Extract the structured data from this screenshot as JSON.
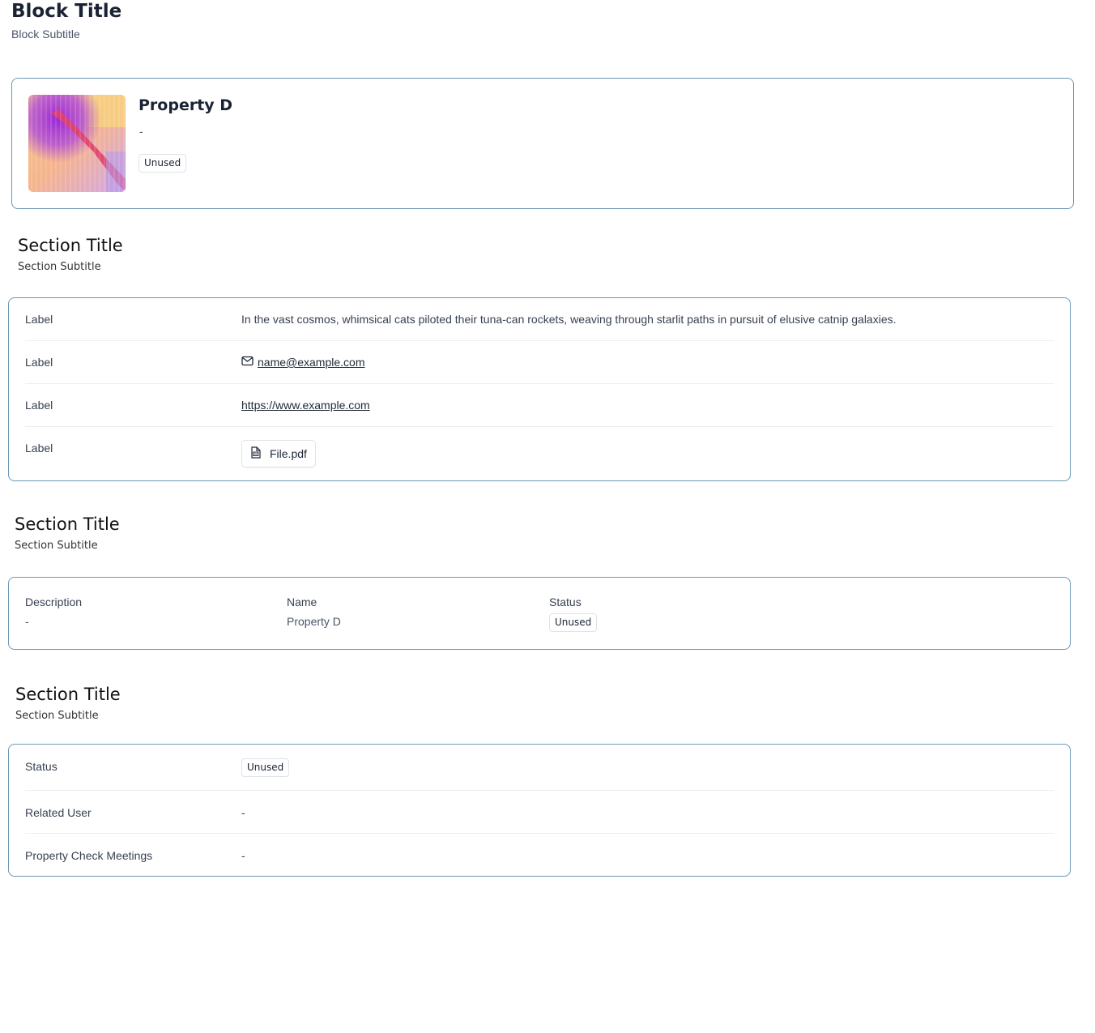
{
  "block": {
    "title": "Block Title",
    "subtitle": "Block Subtitle"
  },
  "hero": {
    "name": "Property D",
    "description": "-",
    "status": "Unused"
  },
  "section1": {
    "title": "Section Title",
    "subtitle": "Section Subtitle",
    "rows": [
      {
        "label": "Label",
        "value": "In the vast cosmos, whimsical cats piloted their tuna-can rockets, weaving through starlit paths in pursuit of elusive catnip galaxies."
      },
      {
        "label": "Label",
        "value": "name@example.com"
      },
      {
        "label": "Label",
        "value": "https://www.example.com"
      },
      {
        "label": "Label",
        "value": "File.pdf"
      }
    ]
  },
  "section2": {
    "title": "Section Title",
    "subtitle": "Section Subtitle",
    "fields": [
      {
        "label": "Description",
        "value": "-"
      },
      {
        "label": "Name",
        "value": "Property D"
      },
      {
        "label": "Status",
        "value": "Unused"
      }
    ]
  },
  "section3": {
    "title": "Section Title",
    "subtitle": "Section Subtitle",
    "rows": [
      {
        "label": "Status",
        "value": "Unused"
      },
      {
        "label": "Related User",
        "value": "-"
      },
      {
        "label": "Property Check Meetings",
        "value": "-"
      }
    ]
  },
  "icons": {
    "email": "mail-icon",
    "file": "file-document-icon"
  },
  "colors": {
    "card_border": "#6c98b6",
    "divider": "#eceef1"
  }
}
